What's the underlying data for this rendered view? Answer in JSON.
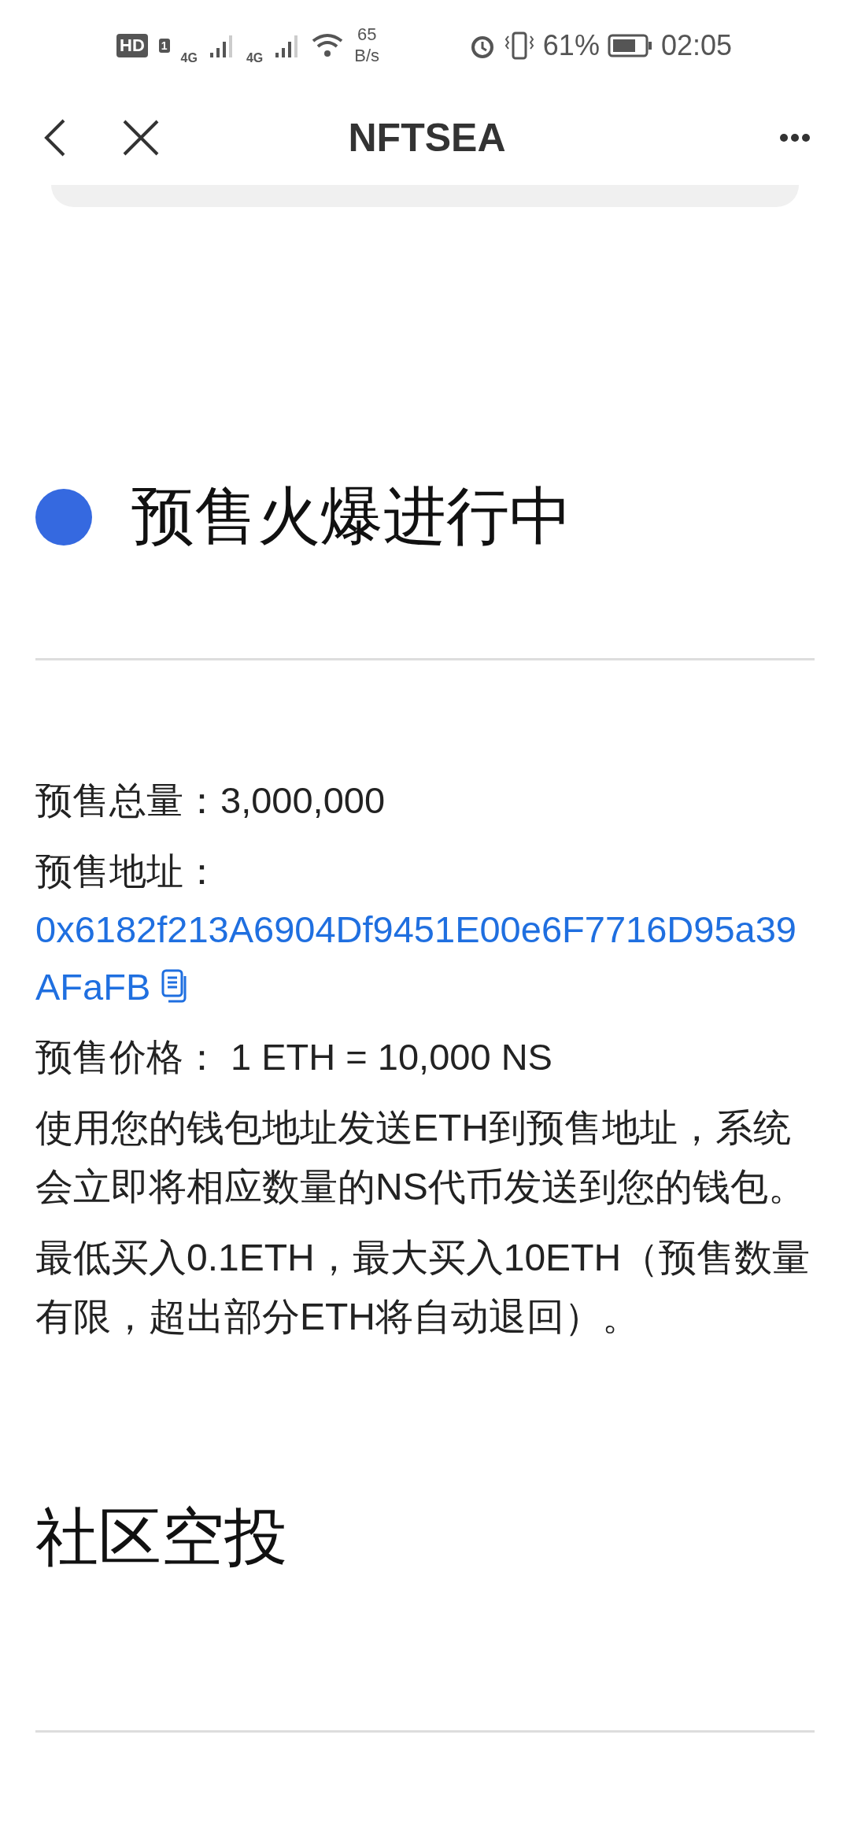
{
  "status_bar": {
    "hd": "HD",
    "sim": "1",
    "networks": [
      "4G",
      "4G"
    ],
    "speed_value": "65",
    "speed_unit": "B/s",
    "battery": "61%",
    "time": "02:05"
  },
  "nav": {
    "title": "NFTSEA"
  },
  "presale": {
    "heading": "预售火爆进行中",
    "color": "#3569e0",
    "total_label": "预售总量：",
    "total_value": "3,000,000",
    "address_label": "预售地址：",
    "address": "0x6182f213A6904Df9451E00e6F7716D95a39AFaFB",
    "price_label": "预售价格：",
    "price_value": "1 ETH = 10,000 NS",
    "paragraphs": [
      "使用您的钱包地址发送ETH到预售地址，系统会立即将相应数量的NS代币发送到您的钱包。",
      "最低买入0.1ETH，最大买入10ETH（预售数量有限，超出部分ETH将自动退回）。"
    ]
  },
  "airdrop": {
    "heading": "社区空投"
  }
}
